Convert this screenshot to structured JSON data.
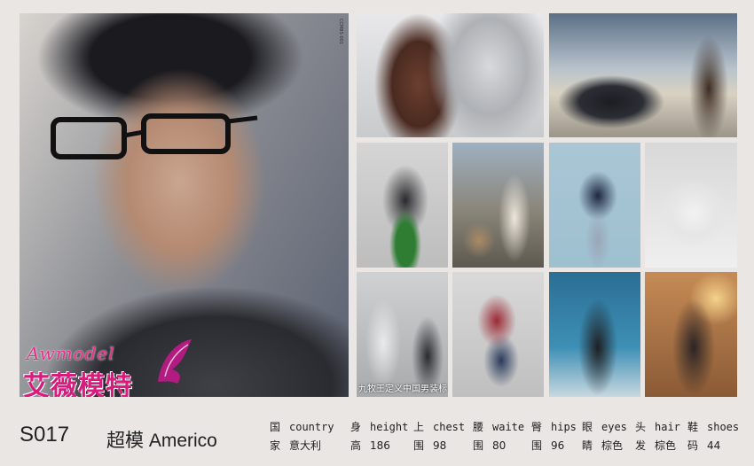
{
  "main_photo": {
    "side_code": "CCM8S-001",
    "logo_latin": "Awmodel",
    "logo_cn": "艾薇模特"
  },
  "thumbs": {
    "suits_caption": "九牧王定义中国男装标"
  },
  "model": {
    "code": "S017",
    "title": "超模 Americo"
  },
  "stats": [
    {
      "cn1": "国",
      "cn2": "家",
      "label": "country",
      "value": "意大利"
    },
    {
      "cn1": "身",
      "cn2": "高",
      "label": "height",
      "value": "186"
    },
    {
      "cn1": "上",
      "cn2": "围",
      "label": "chest",
      "value": "98"
    },
    {
      "cn1": "腰",
      "cn2": "围",
      "label": "waite",
      "value": "80"
    },
    {
      "cn1": "臀",
      "cn2": "围",
      "label": "hips",
      "value": "96"
    },
    {
      "cn1": "眼",
      "cn2": "睛",
      "label": "eyes",
      "value": "棕色"
    },
    {
      "cn1": "头",
      "cn2": "发",
      "label": "hair",
      "value": "棕色"
    },
    {
      "cn1": "鞋",
      "cn2": "码",
      "label": "shoes",
      "value": "44"
    }
  ],
  "colors": {
    "logo_pink": "#d81b7c",
    "background": "#e9e6e4"
  }
}
